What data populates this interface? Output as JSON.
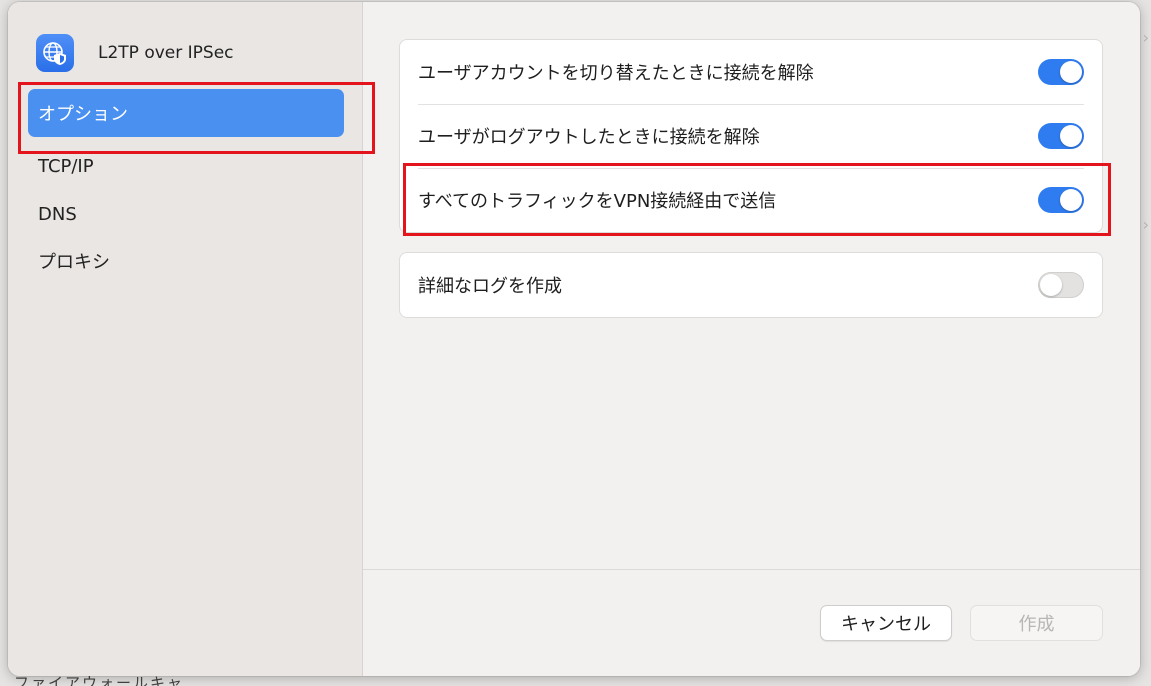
{
  "background": {
    "bottom_text": "ファイアウォールキャ"
  },
  "sidebar": {
    "title": "L2TP over IPSec",
    "app_icon": "globe-shield-icon",
    "items": [
      {
        "label": "オプション",
        "selected": true
      },
      {
        "label": "TCP/IP",
        "selected": false
      },
      {
        "label": "DNS",
        "selected": false
      },
      {
        "label": "プロキシ",
        "selected": false
      }
    ]
  },
  "options": {
    "group1": [
      {
        "label": "ユーザアカウントを切り替えたときに接続を解除",
        "on": true
      },
      {
        "label": "ユーザがログアウトしたときに接続を解除",
        "on": true
      },
      {
        "label": "すべてのトラフィックをVPN接続経由で送信",
        "on": true
      }
    ],
    "group2": [
      {
        "label": "詳細なログを作成",
        "on": false
      }
    ]
  },
  "footer": {
    "cancel_label": "キャンセル",
    "create_label": "作成",
    "create_enabled": false
  },
  "colors": {
    "accent": "#2f7bf0",
    "selection": "#4a90f0",
    "highlight_box": "#e3141c"
  }
}
